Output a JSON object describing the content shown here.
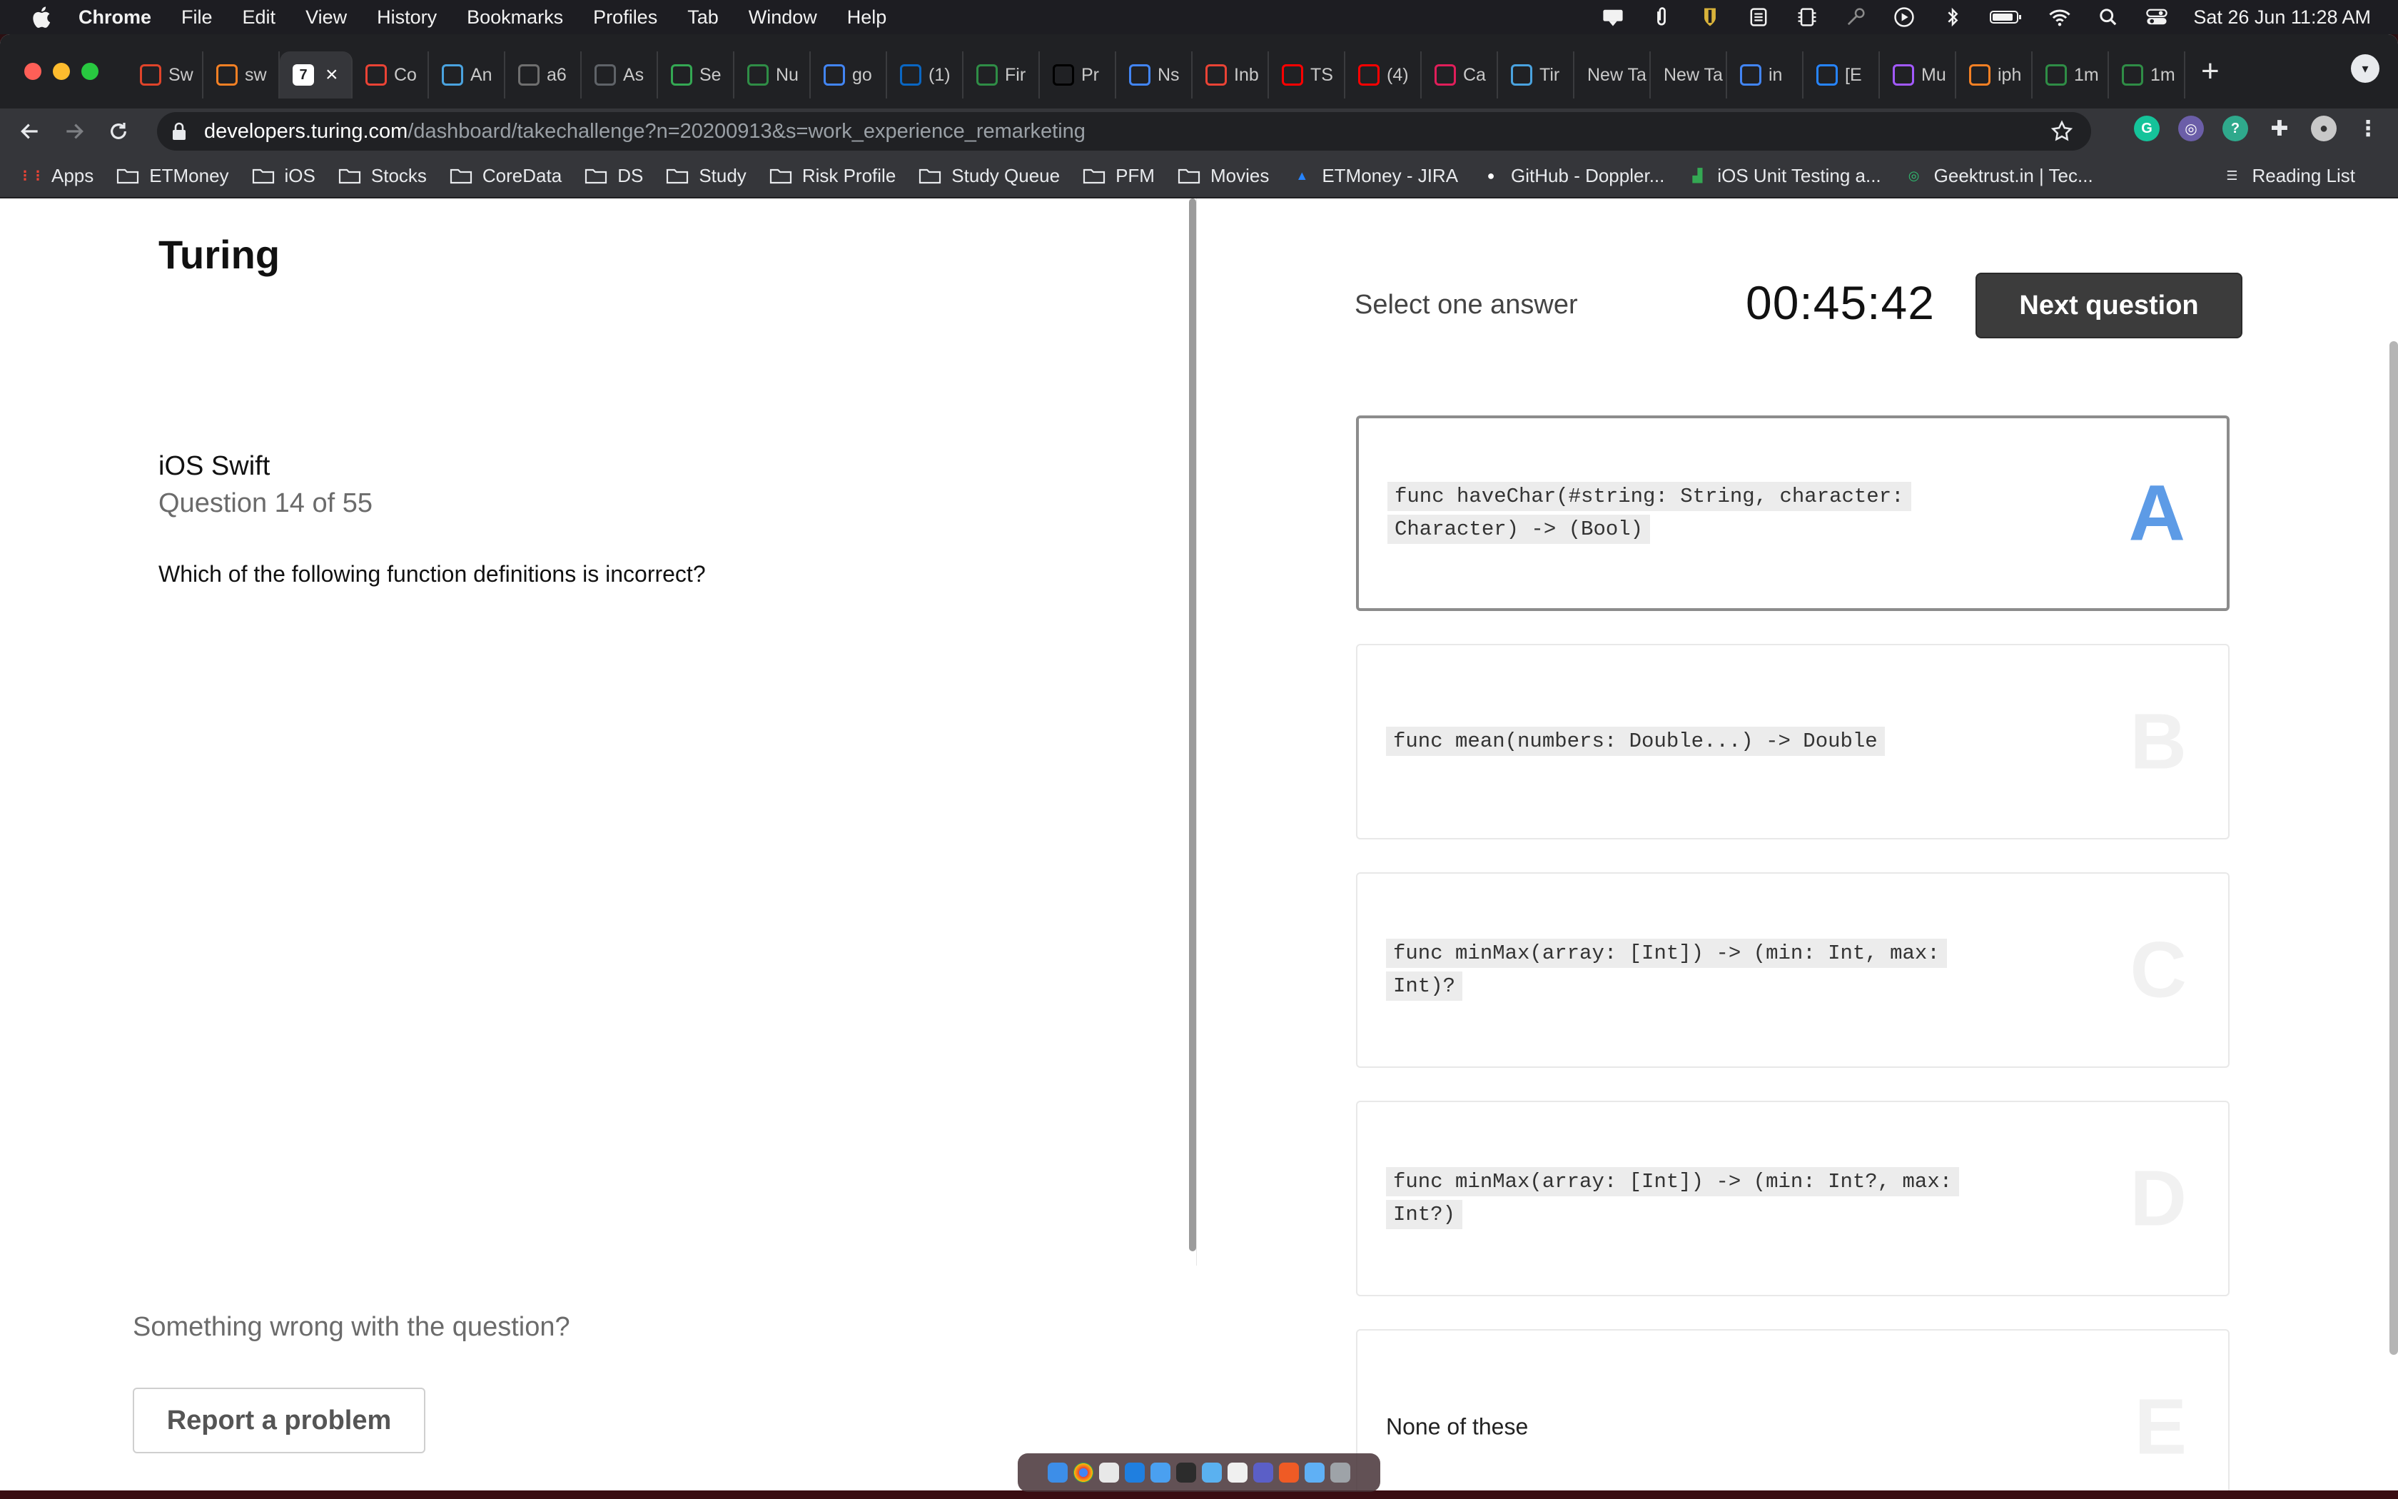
{
  "menubar": {
    "app_name": "Chrome",
    "menus": [
      "File",
      "Edit",
      "View",
      "History",
      "Bookmarks",
      "Profiles",
      "Tab",
      "Window",
      "Help"
    ],
    "clock": "Sat 26 Jun  11:28 AM"
  },
  "tabs": [
    {
      "label": "Sw",
      "icon": "swift-icon",
      "color": "#e0442a"
    },
    {
      "label": "sw",
      "icon": "stackoverflow-icon",
      "color": "#f48024"
    },
    {
      "label": "",
      "icon": "turing-icon",
      "color": "#ffffff",
      "active": true
    },
    {
      "label": "Co",
      "icon": "gmail-icon",
      "color": "#ea4335"
    },
    {
      "label": "An",
      "icon": "d-icon",
      "color": "#4aa3df"
    },
    {
      "label": "a6",
      "icon": "globe-icon",
      "color": "#6f6f6f"
    },
    {
      "label": "As",
      "icon": "doc-icon",
      "color": "#5f6368"
    },
    {
      "label": "Se",
      "icon": "phone-icon",
      "color": "#34a853"
    },
    {
      "label": "Nu",
      "icon": "geeks-icon",
      "color": "#2f8d46"
    },
    {
      "label": "go",
      "icon": "google-icon",
      "color": "#4285f4"
    },
    {
      "label": "(1)",
      "icon": "linkedin-icon",
      "color": "#0a66c2"
    },
    {
      "label": "Fir",
      "icon": "geeks-icon",
      "color": "#2f8d46"
    },
    {
      "label": "Pr",
      "icon": "medium-icon",
      "color": "#000000"
    },
    {
      "label": "Ns",
      "icon": "google-icon",
      "color": "#4285f4"
    },
    {
      "label": "Inb",
      "icon": "gmail-icon",
      "color": "#ea4335"
    },
    {
      "label": "TS",
      "icon": "youtube-icon",
      "color": "#ff0000"
    },
    {
      "label": "(4)",
      "icon": "youtube-icon",
      "color": "#ff0000"
    },
    {
      "label": "Ca",
      "icon": "slack-icon",
      "color": "#e01e5a"
    },
    {
      "label": "Tir",
      "icon": "d-icon",
      "color": "#4aa3df"
    },
    {
      "label": "New Ta",
      "icon": "",
      "color": ""
    },
    {
      "label": "New Ta",
      "icon": "",
      "color": ""
    },
    {
      "label": "in",
      "icon": "google-icon",
      "color": "#4285f4"
    },
    {
      "label": "[E",
      "icon": "jira-icon",
      "color": "#2684ff"
    },
    {
      "label": "Mu",
      "icon": "figma-icon",
      "color": "#a259ff"
    },
    {
      "label": "iph",
      "icon": "stackoverflow-icon",
      "color": "#f48024"
    },
    {
      "label": "1m",
      "icon": "geeks-icon",
      "color": "#2f8d46"
    },
    {
      "label": "1m",
      "icon": "geeks-icon",
      "color": "#2f8d46"
    }
  ],
  "address": {
    "host": "developers.turing.com",
    "path": "/dashboard/takechallenge?n=20200913&s=work_experience_remarketing"
  },
  "bookmarks": [
    {
      "label": "Apps",
      "kind": "apps-icon"
    },
    {
      "label": "ETMoney",
      "kind": "folder-icon"
    },
    {
      "label": "iOS",
      "kind": "folder-icon"
    },
    {
      "label": "Stocks",
      "kind": "folder-icon"
    },
    {
      "label": "CoreData",
      "kind": "folder-icon"
    },
    {
      "label": "DS",
      "kind": "folder-icon"
    },
    {
      "label": "Study",
      "kind": "folder-icon"
    },
    {
      "label": "Risk Profile",
      "kind": "folder-icon"
    },
    {
      "label": "Study Queue",
      "kind": "folder-icon"
    },
    {
      "label": "PFM",
      "kind": "folder-icon"
    },
    {
      "label": "Movies",
      "kind": "folder-icon"
    },
    {
      "label": "ETMoney - JIRA",
      "kind": "atlassian-icon"
    },
    {
      "label": "GitHub - Doppler...",
      "kind": "github-icon"
    },
    {
      "label": "iOS Unit Testing a...",
      "kind": "chart-icon"
    },
    {
      "label": "Geektrust.in | Tec...",
      "kind": "geektrust-icon"
    }
  ],
  "reading_list": "Reading List",
  "page": {
    "brand": "Turing",
    "subject": "iOS Swift",
    "question_number": "Question 14 of 55",
    "question_text": "Which of the following function definitions is incorrect?",
    "report_prompt": "Something wrong with the question?",
    "report_button": "Report a problem",
    "select_label": "Select one answer",
    "timer": "00:45:42",
    "next_button": "Next question",
    "selected_option": "A",
    "options": [
      {
        "letter": "A",
        "text": "func haveChar(#string: String, character: Character) -> (Bool)",
        "code": true
      },
      {
        "letter": "B",
        "text": "func mean(numbers: Double...) -> Double",
        "code": true
      },
      {
        "letter": "C",
        "text": "func minMax(array: [Int]) -> (min: Int, max: Int)?",
        "code": true
      },
      {
        "letter": "D",
        "text": "func minMax(array: [Int]) -> (min: Int?, max: Int?)",
        "code": true
      },
      {
        "letter": "E",
        "text": "None of these",
        "code": false
      }
    ]
  }
}
